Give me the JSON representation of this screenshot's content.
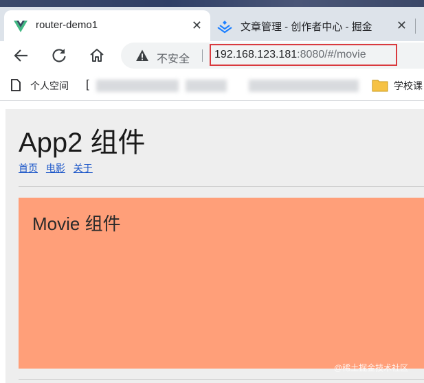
{
  "tabs": [
    {
      "title": "router-demo1",
      "active": true,
      "icon": "vue-icon"
    },
    {
      "title": "文章管理 - 创作者中心 - 掘金",
      "active": false,
      "icon": "juejin-icon"
    }
  ],
  "toolbar": {
    "security_label": "不安全",
    "url_host": "192.168.123.181",
    "url_rest": ":8080/#/movie"
  },
  "bookmarks": {
    "first_label": "个人空间",
    "bracket": "[",
    "folder_label": "学校课"
  },
  "page": {
    "app_title": "App2 组件",
    "nav_links": [
      "首页",
      "电影",
      "关于"
    ],
    "movie_title": "Movie 组件"
  },
  "watermark": "@稀土掘金技术社区",
  "colors": {
    "highlight_border": "#d93a3e",
    "movie_bg": "#ff9f79",
    "app_bg": "#eeeeee",
    "link": "#1a55c8"
  }
}
